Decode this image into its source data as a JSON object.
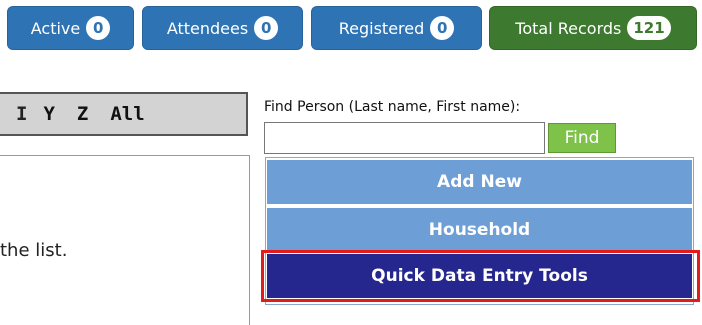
{
  "status_buttons": {
    "active": {
      "label": "Active",
      "count": "0"
    },
    "attendees": {
      "label": "Attendees",
      "count": "0"
    },
    "registered": {
      "label": "Registered",
      "count": "0"
    },
    "total": {
      "label": "Total Records",
      "count": "121"
    }
  },
  "alphabet": {
    "partial": "I",
    "letters": [
      "Y",
      "Z",
      "All"
    ]
  },
  "left_panel": {
    "note": "the list."
  },
  "find": {
    "label": "Find Person (Last name, First name):",
    "value": "",
    "button": "Find"
  },
  "menu": {
    "add_new": "Add New",
    "household": "Household",
    "quick_tools": "Quick Data Entry Tools"
  },
  "colors": {
    "primary_blue": "#2e74b5",
    "success_green": "#3d7a2f",
    "menu_light_blue": "#6d9fd6",
    "menu_dark_blue": "#25278f",
    "find_green": "#7ec24a",
    "highlight_red": "#e21c1c"
  }
}
